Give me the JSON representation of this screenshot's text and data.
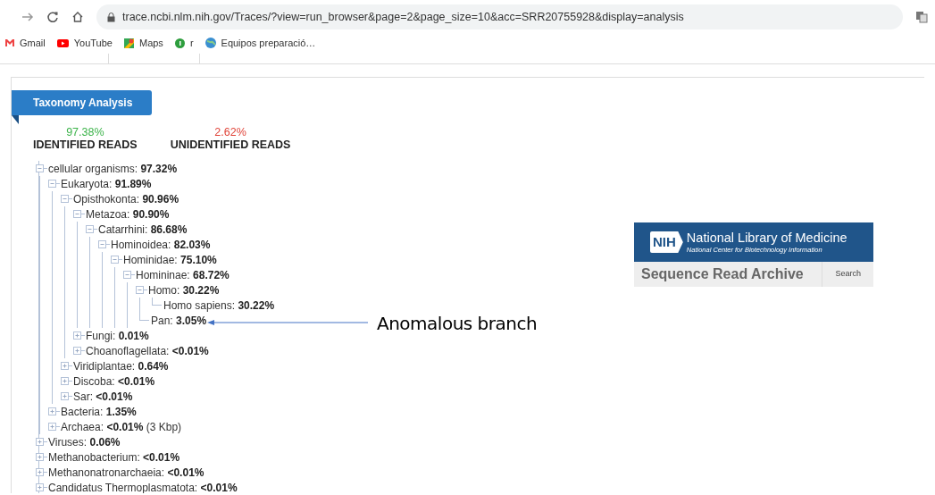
{
  "browser": {
    "url": "trace.ncbi.nlm.nih.gov/Traces/?view=run_browser&page=2&page_size=10&acc=SRR20755928&display=analysis",
    "bookmarks": [
      {
        "label": "Gmail",
        "kind": "gmail"
      },
      {
        "label": "YouTube",
        "kind": "youtube"
      },
      {
        "label": "Maps",
        "kind": "maps"
      },
      {
        "label": "r",
        "kind": "r"
      },
      {
        "label": "Equipos preparació…",
        "kind": "globe"
      }
    ]
  },
  "panel": {
    "title": "Taxonomy Analysis",
    "stats": [
      {
        "value": "97.38%",
        "label": "IDENTIFIED READS",
        "color": "#3cb34a"
      },
      {
        "value": "2.62%",
        "label": "UNIDENTIFIED READS",
        "color": "#e0453a"
      }
    ],
    "tree": [
      {
        "name": "cellular organisms:",
        "value": "97.32%",
        "expanded": true,
        "children": [
          {
            "name": "Eukaryota:",
            "value": "91.89%",
            "expanded": true,
            "children": [
              {
                "name": "Opisthokonta:",
                "value": "90.96%",
                "expanded": true,
                "children": [
                  {
                    "name": "Metazoa:",
                    "value": "90.90%",
                    "expanded": true,
                    "children": [
                      {
                        "name": "Catarrhini:",
                        "value": "86.68%",
                        "expanded": true,
                        "children": [
                          {
                            "name": "Hominoidea:",
                            "value": "82.03%",
                            "expanded": true,
                            "children": [
                              {
                                "name": "Hominidae:",
                                "value": "75.10%",
                                "expanded": true,
                                "children": [
                                  {
                                    "name": "Homininae:",
                                    "value": "68.72%",
                                    "expanded": true,
                                    "children": [
                                      {
                                        "name": "Homo:",
                                        "value": "30.22%",
                                        "expanded": true,
                                        "children": [
                                          {
                                            "name": "Homo sapiens:",
                                            "value": "30.22%"
                                          }
                                        ]
                                      },
                                      {
                                        "name": "Pan:",
                                        "value": "3.05%"
                                      }
                                    ]
                                  }
                                ]
                              }
                            ]
                          }
                        ]
                      }
                    ]
                  },
                  {
                    "name": "Fungi:",
                    "value": "0.01%",
                    "expanded": false
                  },
                  {
                    "name": "Choanoflagellata:",
                    "value": "<0.01%",
                    "expanded": false
                  }
                ]
              },
              {
                "name": "Viridiplantae:",
                "value": "0.64%",
                "expanded": false
              },
              {
                "name": "Discoba:",
                "value": "<0.01%",
                "expanded": false
              },
              {
                "name": "Sar:",
                "value": "<0.01%",
                "expanded": false
              }
            ]
          },
          {
            "name": "Bacteria:",
            "value": "1.35%",
            "expanded": false
          },
          {
            "name": "Archaea:",
            "value": "<0.01%",
            "note": "(3 Kbp)",
            "expanded": false
          }
        ]
      },
      {
        "name": "Viruses:",
        "value": "0.06%",
        "expanded": false
      },
      {
        "name": "Methanobacterium:",
        "value": "<0.01%",
        "expanded": false
      },
      {
        "name": "Methanonatronarchaeia:",
        "value": "<0.01%",
        "expanded": false
      },
      {
        "name": "Candidatus Thermoplasmatota:",
        "value": "<0.01%",
        "expanded": false
      }
    ]
  },
  "banner": {
    "logo": "NIH",
    "title": "National Library of Medicine",
    "subtitle": "National Center for Biotechnology Information",
    "app": "Sequence Read Archive",
    "search": "Search"
  },
  "annotation": {
    "text": "Anomalous branch"
  }
}
